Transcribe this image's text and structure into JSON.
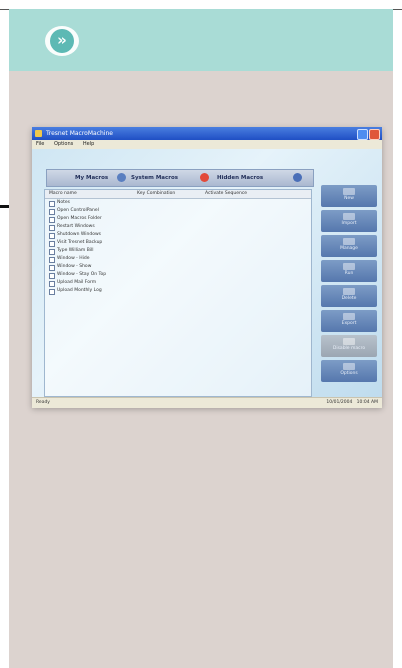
{
  "banner": {
    "badge_glyph": "»",
    "color": "#a9dcd6",
    "badge_color": "#59b8b3"
  },
  "window": {
    "title": "Tresnet MacroMachine",
    "menu": [
      "File",
      "Options",
      "Help"
    ],
    "tabs": [
      "My Macros",
      "System Macros",
      "Hidden Macros"
    ],
    "columns": [
      "Macro name",
      "Key Combination",
      "Activate Sequence"
    ],
    "rows": [
      "Notes",
      "Open ControlPanel",
      "Open Macros Folder",
      "Restart Windows",
      "Shutdown Windows",
      "Visit Tresnet Backup",
      "Type William Bill",
      "Window - Hide",
      "Window - Show",
      "Window - Stay On Top",
      "Upload Mail Form",
      "Upload Monthly Log"
    ],
    "buttons": [
      "New",
      "Import",
      "Manage",
      "Run",
      "Delete",
      "Export",
      "Disable macro",
      "Options"
    ],
    "status_left": "Ready",
    "status_right": [
      "10/01/2004",
      "10:04 AM"
    ]
  }
}
